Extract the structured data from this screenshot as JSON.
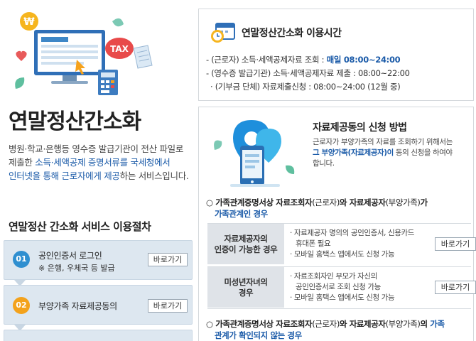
{
  "left": {
    "title": "연말정산간소화",
    "desc_1": "병원·학교·은행등 영수증 발급기관이 전산 파일로",
    "desc_2a": "제출한 ",
    "desc_2b": "소득·세액공제 증명서류를 국세청에서",
    "desc_3a": "인터넷을 통해 근로자에게 제공",
    "desc_3b": "하는 서비스입니다.",
    "steps_title": "연말정산 간소화 서비스 이용절차",
    "hero_tax": "TAX",
    "hero_coin": "₩",
    "steps": [
      {
        "num": "01",
        "label": "공인인증서 로그인",
        "sub": "※ 은행, 우체국 등 발급",
        "button": "바로가기"
      },
      {
        "num": "02",
        "label": "부양가족 자료제공동의",
        "button": "바로가기"
      }
    ]
  },
  "hours": {
    "title": "연말정산간소화 이용시간",
    "line1_label": "- (근로자) 소득·세액공제자료 조회 : ",
    "line1_value": "매일 08:00~24:00",
    "line2": "- (영수증 발급기관) 소득·세액공제자료 제출 : 08:00~22:00",
    "line3": "· (기부금 단체) 자료제출신청 : 08:00~24:00 (12월 중)"
  },
  "consent": {
    "title": "자료제공동의 신청 방법",
    "desc_1": "근로자가 부양가족의 자료를 조회하기 위해서는",
    "desc_2a": "그 부양가족(자료제공자)이",
    "desc_2b": " 동의 신청을 하여야",
    "desc_3": "합니다.",
    "case1_a": "○ 가족관계증명서상 자료조회자",
    "case1_b": "(근로자)",
    "case1_c": "와 자료제공자",
    "case1_d": "(부양가족)",
    "case1_e": "가",
    "case1_f": "가족관계인 경우",
    "rows": [
      {
        "head_1": "자료제공자의",
        "head_2": "인증이 가능한 경우",
        "body_1": "· 자료제공자 명의의 공인인증서, 신용카드",
        "body_2": "휴대폰 필요",
        "body_3": "· 모바일 홈택스 앱에서도 신청 가능",
        "button": "바로가기"
      },
      {
        "head_1": "미성년자녀의",
        "head_2": "경우",
        "body_1": "· 자료조회자인 부모가 자신의",
        "body_2": "공인인증서로 조회 신청 가능",
        "body_3": "· 모바일 홈택스 앱에서도 신청 가능",
        "button": "바로가기"
      }
    ],
    "case2_a": "○ 가족관계증명서상 자료조회자",
    "case2_b": "(근로자)",
    "case2_c": "와 자료제공자",
    "case2_d": "(부양가족)",
    "case2_e": "의 ",
    "case2_f": "가족",
    "case2_g": "관계가 확인되지 않는 경우"
  },
  "colors": {
    "accent_blue": "#1a5aa8",
    "step_blue": "#2f8fd0",
    "step_orange": "#f3a21c",
    "step_bg": "#dde7f0",
    "row_head_bg": "#dfe3e8"
  }
}
